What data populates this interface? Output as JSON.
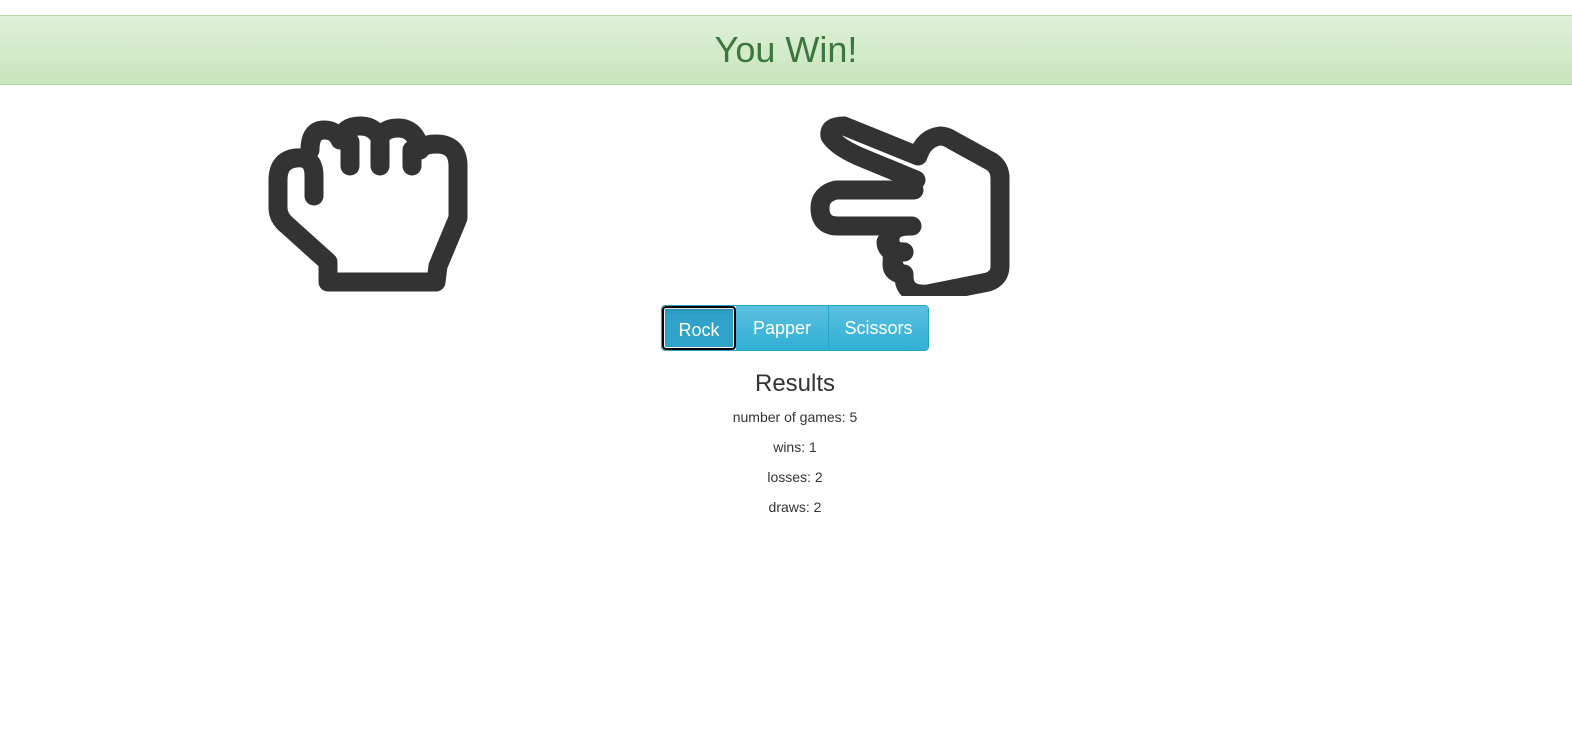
{
  "banner": {
    "message": "You Win!",
    "color": "#3c763d"
  },
  "hands": {
    "player": {
      "icon": "hand-rock-icon"
    },
    "computer": {
      "icon": "hand-scissors-icon"
    }
  },
  "choices": {
    "rock_label": "Rock",
    "paper_label": "Papper",
    "scissors_label": "Scissors",
    "selected": "Rock",
    "accent": "#5bc0de"
  },
  "results": {
    "heading": "Results",
    "games_label": "number of games: 5",
    "wins_label": "wins: 1",
    "losses_label": "losses: 2",
    "draws_label": "draws: 2"
  }
}
